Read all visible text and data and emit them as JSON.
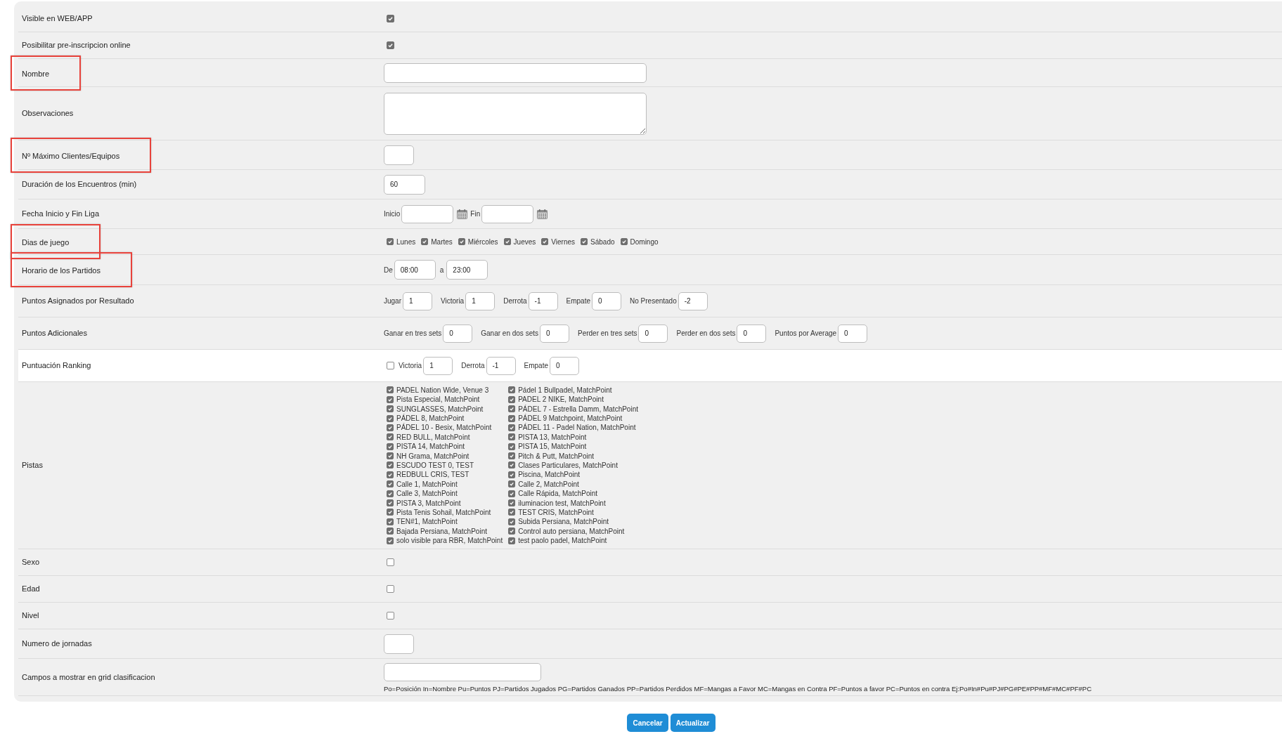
{
  "rows": [
    {
      "kind": "checkbox",
      "label": "Visible en WEB/APP",
      "highlighted": false,
      "hovered": false,
      "checked": true
    },
    {
      "kind": "checkbox",
      "label": "Posibilitar pre-inscripcion online",
      "highlighted": false,
      "hovered": false,
      "checked": true
    },
    {
      "kind": "text",
      "label": "Nombre",
      "highlighted": true,
      "hovered": false
    },
    {
      "kind": "textarea",
      "label": "Observaciones",
      "highlighted": false,
      "hovered": false
    },
    {
      "kind": "number",
      "label": "Nº Máximo Clientes/Equipos",
      "highlighted": true,
      "hovered": false
    },
    {
      "kind": "duration",
      "label": "Duración de los Encuentros (min)",
      "highlighted": false,
      "hovered": false,
      "value": "60"
    },
    {
      "kind": "date_range",
      "label": "Fecha Inicio y Fin Liga",
      "highlighted": false,
      "hovered": false,
      "parts": [
        {
          "label": "Inicio"
        },
        {
          "label": "Fin"
        }
      ]
    },
    {
      "kind": "days",
      "label": "Dias de juego",
      "highlighted": true,
      "hovered": false,
      "days": [
        {
          "label": "Lunes",
          "checked": true
        },
        {
          "label": "Martes",
          "checked": true
        },
        {
          "label": "Miércoles",
          "checked": true
        },
        {
          "label": "Jueves",
          "checked": true
        },
        {
          "label": "Viernes",
          "checked": true
        },
        {
          "label": "Sábado",
          "checked": true
        },
        {
          "label": "Domingo",
          "checked": true
        }
      ]
    },
    {
      "kind": "time_range",
      "label": "Horario de los Partidos",
      "highlighted": true,
      "hovered": false,
      "parts": [
        {
          "label": "De",
          "value": "08:00"
        },
        {
          "label": "a",
          "value": "23:00"
        }
      ]
    },
    {
      "kind": "points",
      "label": "Puntos Asignados por Resultado",
      "highlighted": false,
      "hovered": false,
      "fields": [
        {
          "label": "Jugar",
          "value": "1"
        },
        {
          "label": "Victoria",
          "value": "1"
        },
        {
          "label": "Derrota",
          "value": "-1"
        },
        {
          "label": "Empate",
          "value": "0"
        },
        {
          "label": "No Presentado",
          "value": "-2"
        }
      ]
    },
    {
      "kind": "points",
      "label": "Puntos Adicionales",
      "highlighted": false,
      "hovered": false,
      "fields": [
        {
          "label": "Ganar en tres sets",
          "value": "0"
        },
        {
          "label": "Ganar en dos sets",
          "value": "0"
        },
        {
          "label": "Perder en tres sets",
          "value": "0"
        },
        {
          "label": "Perder en dos sets",
          "value": "0"
        },
        {
          "label": "Puntos por Average",
          "value": "0"
        }
      ]
    },
    {
      "kind": "ranking",
      "label": "Puntuación Ranking",
      "highlighted": false,
      "hovered": true,
      "checked": false,
      "fields": [
        {
          "label": "Victoria",
          "value": "1"
        },
        {
          "label": "Derrota",
          "value": "-1"
        },
        {
          "label": "Empate",
          "value": "0"
        }
      ]
    },
    {
      "kind": "courts",
      "label": "Pistas",
      "highlighted": false,
      "hovered": false,
      "courts": [
        {
          "label": "PADEL Nation Wide, Venue 3",
          "checked": true
        },
        {
          "label": "Pádel 1 Bullpadel, MatchPoint",
          "checked": true
        },
        {
          "label": "Pista Especial, MatchPoint",
          "checked": true
        },
        {
          "label": "PADEL 2 NIKE, MatchPoint",
          "checked": true
        },
        {
          "label": "SUNGLASSES, MatchPoint",
          "checked": true
        },
        {
          "label": "PÁDEL 7 - Estrella Damm, MatchPoint",
          "checked": true
        },
        {
          "label": "PÁDEL 8, MatchPoint",
          "checked": true
        },
        {
          "label": "PÁDEL 9 Matchpoint, MatchPoint",
          "checked": true
        },
        {
          "label": "PÁDEL 10 - Besix, MatchPoint",
          "checked": true
        },
        {
          "label": "PÁDEL 11 - Padel Nation, MatchPoint",
          "checked": true
        },
        {
          "label": "RED BULL, MatchPoint",
          "checked": true
        },
        {
          "label": "PISTA 13, MatchPoint",
          "checked": true
        },
        {
          "label": "PISTA 14, MatchPoint",
          "checked": true
        },
        {
          "label": "PISTA 15, MatchPoint",
          "checked": true
        },
        {
          "label": "NH Grama, MatchPoint",
          "checked": true
        },
        {
          "label": "Pitch & Putt, MatchPoint",
          "checked": true
        },
        {
          "label": "ESCUDO TEST 0, TEST",
          "checked": true
        },
        {
          "label": "Clases Particulares, MatchPoint",
          "checked": true
        },
        {
          "label": "REDBULL CRIS, TEST",
          "checked": true
        },
        {
          "label": "Piscina, MatchPoint",
          "checked": true
        },
        {
          "label": "Calle 1, MatchPoint",
          "checked": true
        },
        {
          "label": "Calle 2, MatchPoint",
          "checked": true
        },
        {
          "label": "Calle 3, MatchPoint",
          "checked": true
        },
        {
          "label": "Calle Rápida, MatchPoint",
          "checked": true
        },
        {
          "label": "PISTA 3, MatchPoint",
          "checked": true
        },
        {
          "label": "iluminacion test, MatchPoint",
          "checked": true
        },
        {
          "label": "Pista Tenis Sohail, MatchPoint",
          "checked": true
        },
        {
          "label": "TEST CRIS, MatchPoint",
          "checked": true
        },
        {
          "label": "TEN#1, MatchPoint",
          "checked": true
        },
        {
          "label": "Subida Persiana, MatchPoint",
          "checked": true
        },
        {
          "label": "Bajada Persiana, MatchPoint",
          "checked": true
        },
        {
          "label": "Control auto persiana, MatchPoint",
          "checked": true
        },
        {
          "label": "solo visible para RBR, MatchPoint",
          "checked": true
        },
        {
          "label": "test paolo padel, MatchPoint",
          "checked": true
        }
      ]
    },
    {
      "kind": "checkbox",
      "label": "Sexo",
      "highlighted": false,
      "hovered": false,
      "checked": false
    },
    {
      "kind": "checkbox",
      "label": "Edad",
      "highlighted": false,
      "hovered": false,
      "checked": false
    },
    {
      "kind": "checkbox",
      "label": "Nivel",
      "highlighted": false,
      "hovered": false,
      "checked": false
    },
    {
      "kind": "number",
      "label": "Numero de jornadas",
      "highlighted": false,
      "hovered": false
    },
    {
      "kind": "text_help",
      "label": "Campos a mostrar en grid clasificacion",
      "highlighted": false,
      "hovered": false,
      "help": "Po=Posición In=Nombre Pu=Puntos PJ=Partidos Jugados PG=Partidos Ganados PP=Partidos Perdidos MF=Mangas a Favor MC=Mangas en Contra PF=Puntos a favor PC=Puntos en contra Ej:Po#In#Pu#PJ#PG#PE#PP#MF#MC#PF#PC"
    }
  ],
  "buttons": [
    {
      "label": "Cancelar"
    },
    {
      "label": "Actualizar"
    }
  ]
}
